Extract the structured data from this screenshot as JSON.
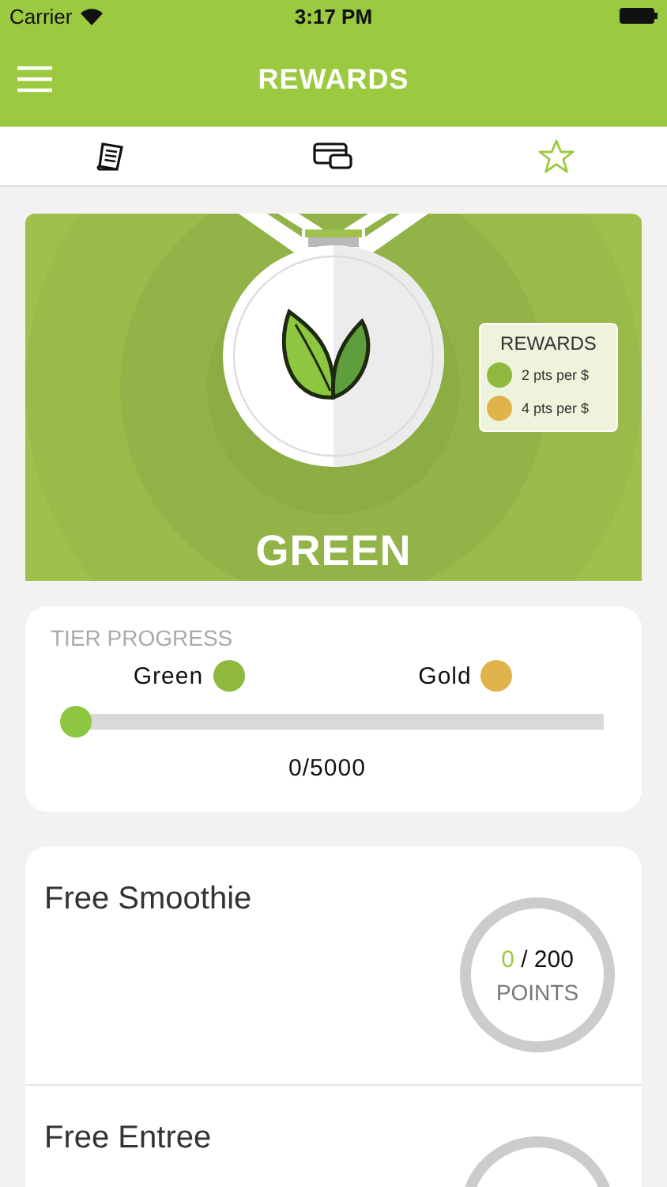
{
  "status_bar": {
    "carrier": "Carrier",
    "time": "3:17 PM"
  },
  "nav": {
    "title": "REWARDS"
  },
  "tabs": [
    {
      "kind": "receipt",
      "selected": false
    },
    {
      "kind": "card",
      "selected": false
    },
    {
      "kind": "star",
      "selected": true
    }
  ],
  "medal": {
    "tier": "GREEN",
    "legend_title": "REWARDS",
    "legend": [
      {
        "text": "2 pts per $",
        "color": "#8fb83e"
      },
      {
        "text": "4 pts per $",
        "color": "#e0b44a"
      }
    ]
  },
  "tier_progress": {
    "title": "TIER PROGRESS",
    "tiers": [
      {
        "name": "Green",
        "color": "#8fb83e"
      },
      {
        "name": "Gold",
        "color": "#e0b44a"
      }
    ],
    "level": 0,
    "reading": "0/5000"
  },
  "rewards": [
    {
      "title": "Free Smoothie",
      "earned": "0",
      "cost": "/ 200",
      "unit": "POINTS"
    },
    {
      "title": "Free Entree"
    }
  ]
}
